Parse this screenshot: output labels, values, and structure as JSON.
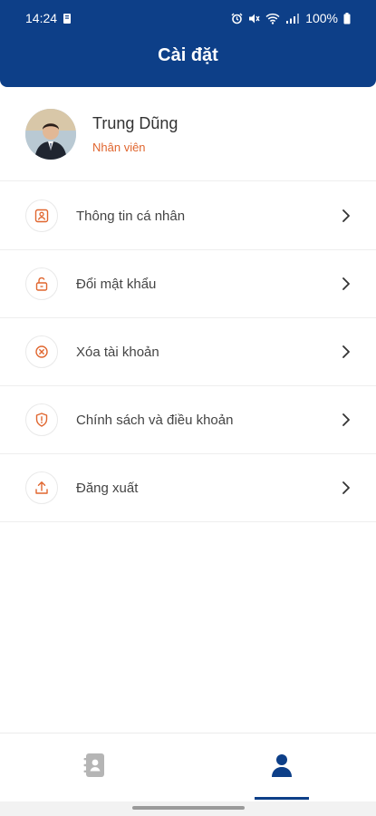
{
  "status_bar": {
    "time": "14:24",
    "battery": "100%",
    "icons": [
      "notification-icon",
      "alarm-icon",
      "mute-icon",
      "wifi-icon",
      "signal-icon",
      "battery-icon"
    ]
  },
  "header": {
    "title": "Cài đặt",
    "background": "#0d3f88"
  },
  "profile": {
    "name": "Trung Dũng",
    "role": "Nhân viên",
    "role_color": "#e0662f"
  },
  "menu": {
    "items": [
      {
        "label": "Thông tin cá nhân",
        "icon": "personal-info-icon"
      },
      {
        "label": "Đổi mật khẩu",
        "icon": "unlock-icon"
      },
      {
        "label": "Xóa tài khoản",
        "icon": "delete-circle-icon"
      },
      {
        "label": "Chính sách và điều khoản",
        "icon": "shield-alert-icon"
      },
      {
        "label": "Đăng xuất",
        "icon": "logout-upload-icon"
      }
    ],
    "icon_color": "#e0662f"
  },
  "bottom_nav": {
    "tabs": [
      {
        "icon": "contacts-book-icon",
        "active": false
      },
      {
        "icon": "user-icon",
        "active": true
      }
    ]
  }
}
